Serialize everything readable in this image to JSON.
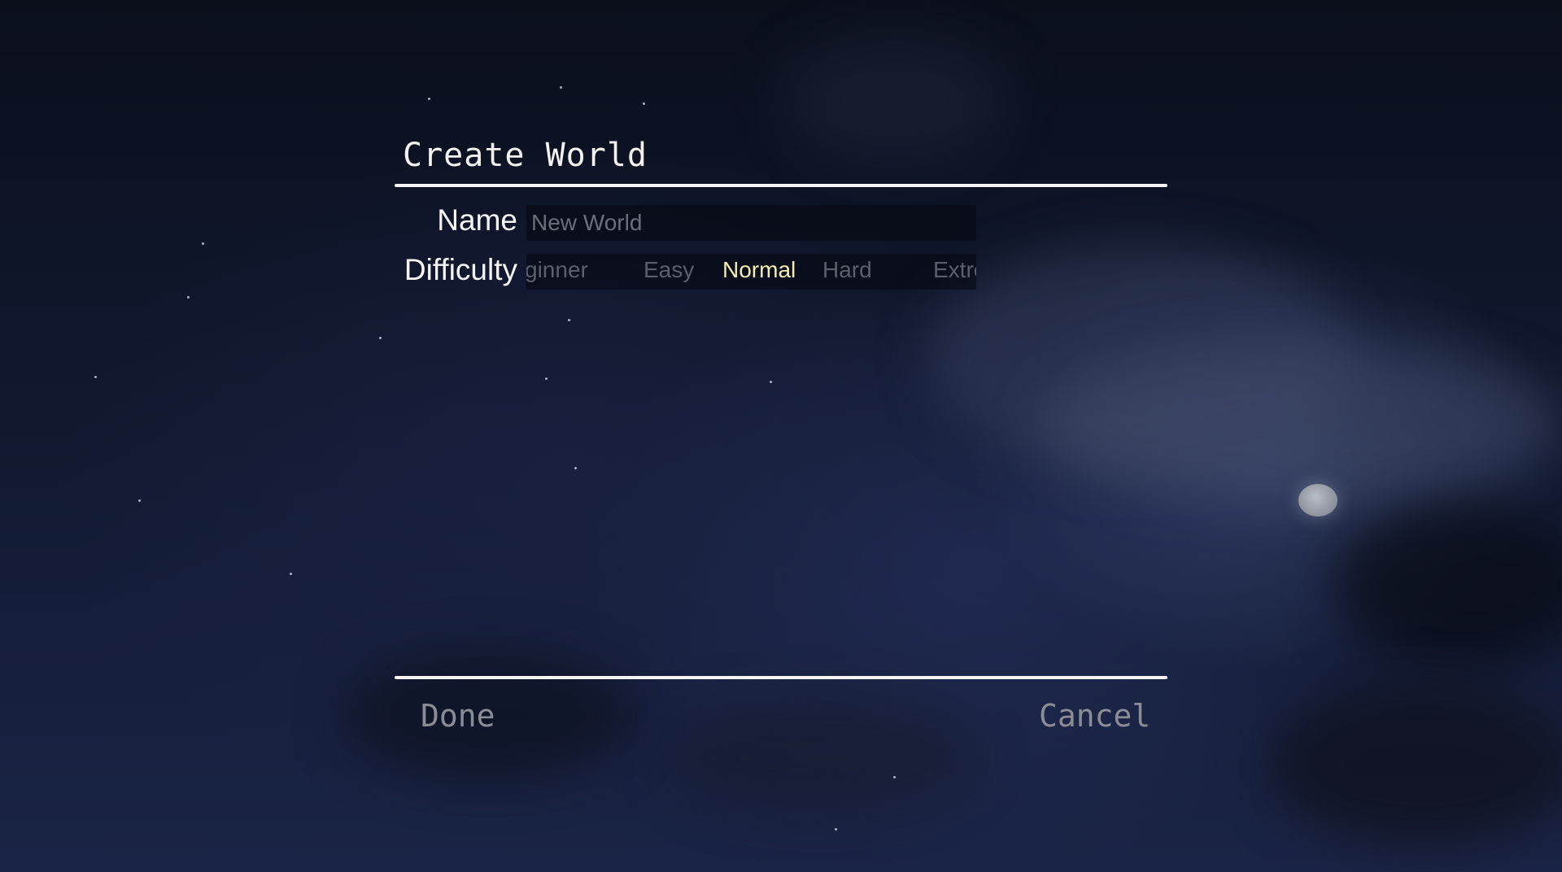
{
  "dialog": {
    "title": "Create World"
  },
  "form": {
    "name_label": "Name",
    "name_placeholder": "New World",
    "name_value": "",
    "difficulty_label": "Difficulty",
    "difficulty_options": [
      {
        "label": "Beginner",
        "visible_text": "ginner"
      },
      {
        "label": "Easy",
        "visible_text": "Easy"
      },
      {
        "label": "Normal",
        "visible_text": "Normal",
        "selected": true
      },
      {
        "label": "Hard",
        "visible_text": "Hard"
      },
      {
        "label": "Extreme",
        "visible_text": "Extre"
      }
    ]
  },
  "footer": {
    "done_label": "Done",
    "cancel_label": "Cancel"
  },
  "colors": {
    "selected_option": "#f2eeb0",
    "unselected_option": "#5b5f6b",
    "footer_button": "#8a8d96",
    "rule": "#f4f4f4"
  }
}
